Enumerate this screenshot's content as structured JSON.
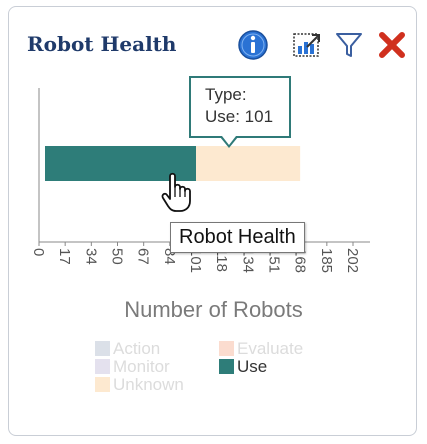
{
  "header": {
    "title": "Robot Health"
  },
  "icons": {
    "info": "info-icon",
    "chart": "chart-options-icon",
    "filter": "filter-icon",
    "close": "close-icon"
  },
  "tooltip": {
    "type_line": "Type:",
    "value_line": "Use: 101"
  },
  "hover_label": "Robot Health",
  "colors": {
    "use": "#2e7d79",
    "unknown": "#fde9d0",
    "action": "#dbe0e8",
    "evaluate": "#fbdccf",
    "monitor": "#e4e1ee",
    "tooltip_border": "#2f7a78"
  },
  "chart_data": {
    "type": "bar",
    "orientation": "horizontal",
    "stacked": true,
    "categories": [
      ""
    ],
    "series": [
      {
        "name": "Use",
        "values": [
          101
        ],
        "color": "#2e7d79"
      },
      {
        "name": "Unknown",
        "values": [
          67
        ],
        "color": "#fde9d0"
      }
    ],
    "xlabel": "Number of Robots",
    "xlim": [
      0,
      202
    ],
    "xticks": [
      "0",
      "17",
      "34",
      "50",
      "67",
      "84",
      "101",
      "118",
      "134",
      "151",
      "168",
      "185",
      "202"
    ],
    "legend": [
      {
        "name": "Action",
        "color": "#dbe0e8",
        "active": false
      },
      {
        "name": "Evaluate",
        "color": "#fbdccf",
        "active": false
      },
      {
        "name": "Monitor",
        "color": "#e4e1ee",
        "active": false
      },
      {
        "name": "Use",
        "color": "#2e7d79",
        "active": true
      },
      {
        "name": "Unknown",
        "color": "#fde9d0",
        "active": false
      }
    ],
    "legend_position": "bottom"
  }
}
